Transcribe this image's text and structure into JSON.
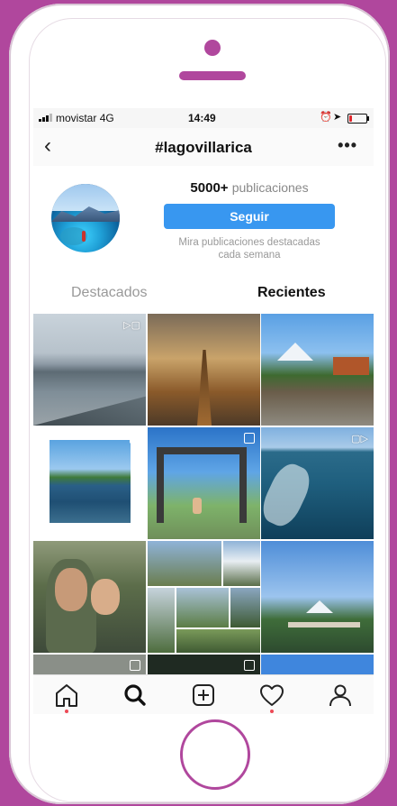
{
  "status": {
    "carrier": "movistar",
    "network": "4G",
    "time": "14:49",
    "battery_fraction": 0.15
  },
  "nav": {
    "back": "‹",
    "title": "#lagovillarica",
    "more": "•••"
  },
  "header": {
    "count": "5000+",
    "count_label": "publicaciones",
    "follow": "Seguir",
    "hint_line1": "Mira publicaciones destacadas",
    "hint_line2": "cada semana"
  },
  "tabs": {
    "featured": "Destacados",
    "recent": "Recientes"
  },
  "grid": {
    "video_icon": "video-icon",
    "multi_icon": "multiple-photos-icon"
  },
  "tabbar": {
    "items": [
      "home-icon",
      "search-icon",
      "add-icon",
      "heart-icon",
      "profile-icon"
    ]
  },
  "colors": {
    "accent": "#3897f0",
    "frame": "#b0479d",
    "notification": "#ed4956"
  }
}
